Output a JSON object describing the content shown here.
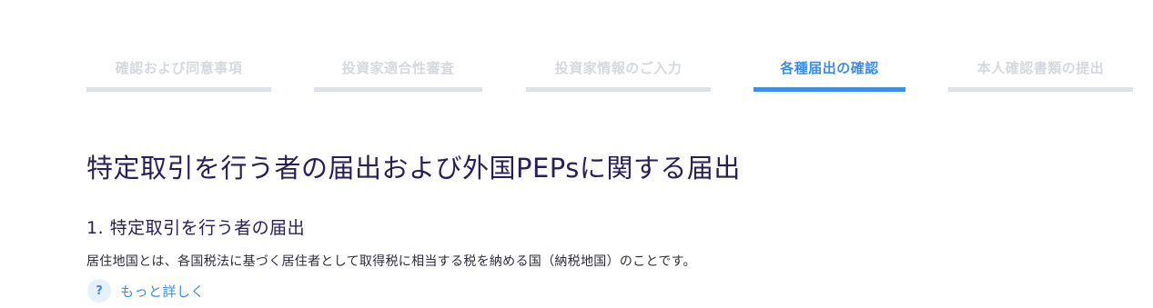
{
  "steps": [
    {
      "label": "確認および同意事項",
      "state": "inactive"
    },
    {
      "label": "投資家適合性審査",
      "state": "inactive"
    },
    {
      "label": "投資家情報のご入力",
      "state": "inactive"
    },
    {
      "label": "各種届出の確認",
      "state": "active"
    },
    {
      "label": "本人確認書類の提出",
      "state": "inactive"
    }
  ],
  "page": {
    "title": "特定取引を行う者の届出および外国PEPsに関する届出"
  },
  "section1": {
    "title": "1. 特定取引を行う者の届出",
    "description": "居住地国とは、各国税法に基づく居住者として取得税に相当する税を納める国（納税地国）のことです。",
    "more_link": "もっと詳しく",
    "help_icon_glyph": "?"
  },
  "colors": {
    "accent": "#3d8ce6",
    "heading": "#2b1e57",
    "inactive_step": "#d5d9de"
  }
}
